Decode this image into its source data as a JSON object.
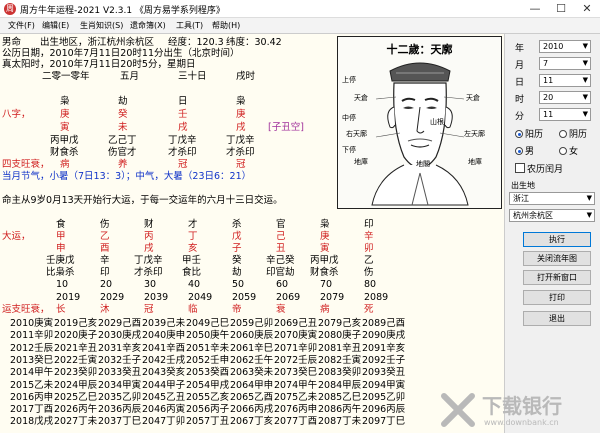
{
  "window": {
    "title": "周方牛年运程-2021  V2.3.1  《周方易学系列程序》",
    "icon": "周",
    "min": "—",
    "max": "☐",
    "close": "✕"
  },
  "menu": [
    "文件(F)",
    "编辑(E)",
    "生肖知识(S)",
    "遗命簿(X)",
    "工具(T)",
    "帮助(H)"
  ],
  "info": {
    "gender": "男命",
    "birthplace": "出生地区，浙江杭州余杭区",
    "longitude": "经度：120.3",
    "latitude": "纬度：30.42",
    "gregorian": "公历日期，2010年7月11日20时11分出生（北京时间）",
    "solar_time": "真太阳时，2010年7月11日20时5分，星期日",
    "lunar": [
      "二零一零年",
      "五月",
      "三十日",
      "戌时"
    ]
  },
  "bazi": {
    "shishen": [
      "枭",
      "劫",
      "日",
      "枭"
    ],
    "label": "八字，",
    "gan": [
      "庚",
      "癸",
      "壬",
      "庚"
    ],
    "zhi": [
      "寅",
      "未",
      "戌",
      "戌"
    ],
    "kongwang": "[子丑空]",
    "canggan": [
      "丙甲戊",
      "乙己丁",
      "丁戊辛",
      "丁戊辛"
    ],
    "canggan_shishen": [
      "财食杀",
      "伤官才",
      "才杀印",
      "才杀印"
    ],
    "wangshuai_label": "四支旺衰，",
    "wangshuai": [
      "病",
      "养",
      "冠",
      "冠"
    ],
    "jieqi": "当月节气，小暑（7日13：3）；中气，大暑（23日6：21）"
  },
  "dayun": {
    "intro": "命主从9岁0月13天开始行大运，于每一交运年的六月十三日交运。",
    "shishen": [
      "食",
      "伤",
      "财",
      "才",
      "杀",
      "官",
      "枭",
      "印"
    ],
    "label": "大运，",
    "gan": [
      "甲",
      "乙",
      "丙",
      "丁",
      "戊",
      "己",
      "庚",
      "辛"
    ],
    "zhi": [
      "申",
      "酉",
      "戌",
      "亥",
      "子",
      "丑",
      "寅",
      "卯"
    ],
    "canggan": [
      "壬庚戊",
      "辛",
      "丁戊辛",
      "甲壬",
      "癸",
      "辛己癸",
      "丙甲戊",
      "乙"
    ],
    "canggan_shishen": [
      "比枭杀",
      "印",
      "才杀印",
      "食比",
      "劫",
      "印官劫",
      "财食杀",
      "伤"
    ],
    "ages": [
      "10",
      "20",
      "30",
      "40",
      "50",
      "60",
      "70",
      "80"
    ],
    "years": [
      "2019",
      "2029",
      "2039",
      "2049",
      "2059",
      "2069",
      "2079",
      "2089"
    ],
    "wangshuai_label": "运支旺衰，",
    "wangshuai": [
      "长",
      "沐",
      "冠",
      "临",
      "帝",
      "衰",
      "病",
      "死"
    ]
  },
  "liunian": [
    [
      "2010庚寅",
      "2019己亥",
      "2029己酉",
      "2039己未",
      "2049己巳",
      "2059己卯",
      "2069己丑",
      "2079己亥",
      "2089己酉"
    ],
    [
      "2011辛卯",
      "2020庚子",
      "2030庚戌",
      "2040庚申",
      "2050庚午",
      "2060庚辰",
      "2070庚寅",
      "2080庚子",
      "2090庚戌"
    ],
    [
      "2012壬辰",
      "2021辛丑",
      "2031辛亥",
      "2041辛酉",
      "2051辛未",
      "2061辛巳",
      "2071辛卯",
      "2081辛丑",
      "2091辛亥"
    ],
    [
      "2013癸巳",
      "2022壬寅",
      "2032壬子",
      "2042壬戌",
      "2052壬申",
      "2062壬午",
      "2072壬辰",
      "2082壬寅",
      "2092壬子"
    ],
    [
      "2014甲午",
      "2023癸卯",
      "2033癸丑",
      "2043癸亥",
      "2053癸酉",
      "2063癸未",
      "2073癸巳",
      "2083癸卯",
      "2093癸丑"
    ],
    [
      "2015乙未",
      "2024甲辰",
      "2034甲寅",
      "2044甲子",
      "2054甲戌",
      "2064甲申",
      "2074甲午",
      "2084甲辰",
      "2094甲寅"
    ],
    [
      "2016丙申",
      "2025乙巳",
      "2035乙卯",
      "2045乙丑",
      "2055乙亥",
      "2065乙酉",
      "2075乙未",
      "2085乙巳",
      "2095乙卯"
    ],
    [
      "2017丁酉",
      "2026丙午",
      "2036丙辰",
      "2046丙寅",
      "2056丙子",
      "2066丙戌",
      "2076丙申",
      "2086丙午",
      "2096丙辰"
    ],
    [
      "2018戊戌",
      "2027丁未",
      "2037丁巳",
      "2047丁卯",
      "2057丁丑",
      "2067丁亥",
      "2077丁酉",
      "2087丁未",
      "2097丁巳"
    ]
  ],
  "portrait": {
    "title": "十二歲：天廓",
    "labels": [
      "天倉",
      "天倉",
      "右天廓",
      "左天廓",
      "山根",
      "地閣",
      "地庫",
      "地庫",
      "上停",
      "中停",
      "下停"
    ]
  },
  "form": {
    "year_label": "年",
    "year": "2010",
    "month_label": "月",
    "month": "7",
    "day_label": "日",
    "day": "11",
    "hour_label": "时",
    "hour": "20",
    "minute_label": "分",
    "minute": "11",
    "cal_gregorian": "阳历",
    "cal_lunar": "阴历",
    "sex_male": "男",
    "sex_female": "女",
    "leap_month": "农历闰月",
    "birthplace_label": "出生地",
    "province": "浙江",
    "city": "杭州余杭区",
    "btn_run": "执行",
    "btn_close_flow": "关闭流年图",
    "btn_new_window": "打开新窗口",
    "btn_print": "打印",
    "btn_exit": "退出"
  },
  "watermark": {
    "text": "下载银行",
    "url": "www.downbank.cn"
  },
  "colors": {
    "red": "#d02020",
    "blue": "#1033c8",
    "purple": "#a0309a",
    "panel_bg": "#fffdf2"
  }
}
